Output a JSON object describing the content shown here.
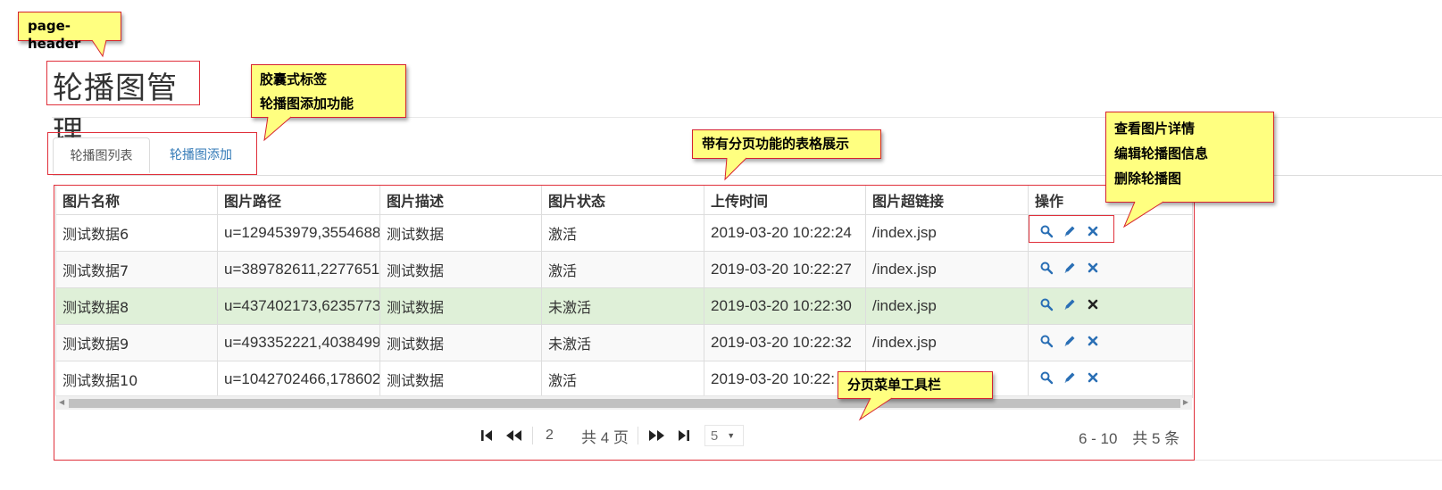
{
  "notes": {
    "page_header": "page-header",
    "tabs_line1": "胶囊式标签",
    "tabs_line2": "轮播图添加功能",
    "table": "带有分页功能的表格展示",
    "ops_line1": "查看图片详情",
    "ops_line2": "编辑轮播图信息",
    "ops_line3": "删除轮播图",
    "pager": "分页菜单工具栏"
  },
  "page": {
    "title": "轮播图管理"
  },
  "tabs": [
    {
      "label": "轮播图列表",
      "active": true
    },
    {
      "label": "轮播图添加",
      "active": false
    }
  ],
  "table": {
    "columns": [
      "图片名称",
      "图片路径",
      "图片描述",
      "图片状态",
      "上传时间",
      "图片超链接",
      "操作"
    ],
    "rows": [
      {
        "name": "测试数据6",
        "path": "u=129453979,3554688",
        "desc": "测试数据",
        "status": "激活",
        "time": "2019-03-20 10:22:24",
        "link": "/index.jsp"
      },
      {
        "name": "测试数据7",
        "path": "u=389782611,2277651",
        "desc": "测试数据",
        "status": "激活",
        "time": "2019-03-20 10:22:27",
        "link": "/index.jsp"
      },
      {
        "name": "测试数据8",
        "path": "u=437402173,6235773",
        "desc": "测试数据",
        "status": "未激活",
        "time": "2019-03-20 10:22:30",
        "link": "/index.jsp"
      },
      {
        "name": "测试数据9",
        "path": "u=493352221,4038499",
        "desc": "测试数据",
        "status": "未激活",
        "time": "2019-03-20 10:22:32",
        "link": "/index.jsp"
      },
      {
        "name": "测试数据10",
        "path": "u=1042702466,178602",
        "desc": "测试数据",
        "status": "激活",
        "time": "2019-03-20 10:22:",
        "link": ""
      }
    ]
  },
  "pager": {
    "page_value": "2",
    "total_pages": "共 4 页",
    "page_size": "5",
    "range": "6 - 10",
    "total": "共 5 条"
  },
  "colors": {
    "link": "#337ab7",
    "selected_row": "#dff0d8",
    "annotation": "#ffff80",
    "annotation_border": "#d6232e"
  },
  "icons": [
    "search-icon",
    "pencil-icon",
    "remove-icon",
    "first-page-icon",
    "prev-page-icon",
    "next-page-icon",
    "last-page-icon",
    "caret-down-icon"
  ]
}
